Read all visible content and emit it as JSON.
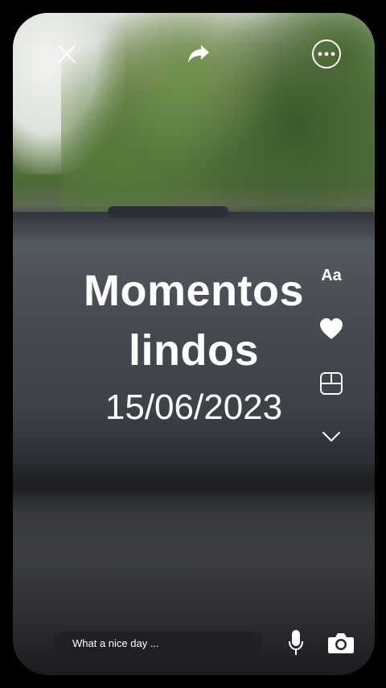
{
  "overlay": {
    "title_line1": "Momentos",
    "title_line2": "lindos",
    "date": "15/06/2023"
  },
  "toolbar_top": {
    "close_icon": "close-icon",
    "share_icon": "share-arrow-icon",
    "more_icon": "more-options-icon"
  },
  "side_tools": {
    "text_label": "Aa",
    "icons": [
      "text-style-icon",
      "heart-icon",
      "layout-grid-icon",
      "chevron-down-icon"
    ]
  },
  "bottom_bar": {
    "input_placeholder": "What a nice day ...",
    "mic_icon": "microphone-icon",
    "camera_icon": "camera-icon"
  },
  "colors": {
    "foreground": "#ffffff",
    "background": "#000000"
  }
}
